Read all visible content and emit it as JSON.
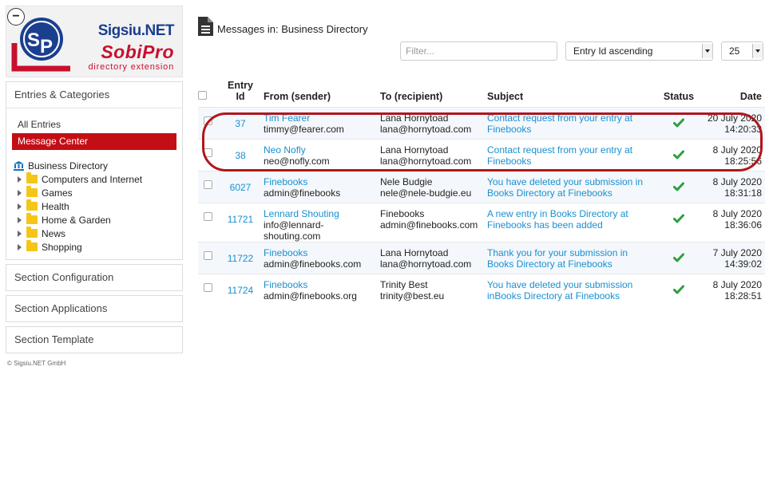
{
  "logo": {
    "collapse_symbol": "−",
    "vendor": "Sigsiu.NET",
    "product": "SobiPro",
    "tagline": "directory extension",
    "brand_blue": "#1b3f8f",
    "brand_red": "#c8102e"
  },
  "sidebar": {
    "entries_header": "Entries & Categories",
    "links": [
      {
        "label": "All Entries",
        "active": false
      },
      {
        "label": "Message Center",
        "active": true
      }
    ],
    "tree_root": "Business Directory",
    "categories": [
      "Computers and Internet",
      "Games",
      "Health",
      "Home & Garden",
      "News",
      "Shopping"
    ],
    "sections": [
      "Section Configuration",
      "Section Applications",
      "Section Template"
    ],
    "copyright": "© Sigsiu.NET GmbH"
  },
  "main": {
    "title": "Messages in: Business Directory",
    "filter_placeholder": "Filter...",
    "sort_value": "Entry Id ascending",
    "limit_value": "25",
    "columns": {
      "entry_id_line1": "Entry",
      "entry_id_line2": "Id",
      "from": "From (sender)",
      "to": "To (recipient)",
      "subject": "Subject",
      "status": "Status",
      "date": "Date"
    },
    "rows": [
      {
        "id": "37",
        "from_name": "Tim Fearer",
        "from_email": "timmy@fearer.com",
        "to_name": "Lana Hornytoad",
        "to_email": "lana@hornytoad.com",
        "subject_1": "Contact request from your entry at",
        "subject_2": "Finebooks",
        "status": "sent",
        "date": "20 July 2020",
        "time": "14:20:33"
      },
      {
        "id": "38",
        "from_name": "Neo Nofly",
        "from_email": "neo@nofly.com",
        "to_name": "Lana Hornytoad",
        "to_email": "lana@hornytoad.com",
        "subject_1": "Contact request from your entry at",
        "subject_2": "Finebooks",
        "status": "sent",
        "date": "8 July 2020",
        "time": "18:25:56"
      },
      {
        "id": "6027",
        "from_name": "Finebooks",
        "from_email": "admin@finebooks",
        "to_name": "Nele Budgie",
        "to_email": "nele@nele-budgie.eu",
        "subject_1": "You have deleted your submission in",
        "subject_2": "Books Directory at Finebooks",
        "status": "sent",
        "date": "8 July 2020",
        "time": "18:31:18"
      },
      {
        "id": "11721",
        "from_name": "Lennard Shouting",
        "from_email": "info@lennard-",
        "from_email_2": "shouting.com",
        "to_name": "Finebooks",
        "to_email": "admin@finebooks.com",
        "subject_1": "A new entry in Books Directory at",
        "subject_2": "Finebooks has been added",
        "status": "sent",
        "date": "8 July 2020",
        "time": "18:36:06"
      },
      {
        "id": "11722",
        "from_name": "Finebooks",
        "from_email": "admin@finebooks.com",
        "to_name": "Lana Hornytoad",
        "to_email": "lana@hornytoad.com",
        "subject_1": "Thank you for your submission in",
        "subject_2": "Books Directory at Finebooks",
        "status": "sent",
        "date": "7 July 2020",
        "time": "14:39:02"
      },
      {
        "id": "11724",
        "from_name": "Finebooks",
        "from_email": "admin@finebooks.org",
        "to_name": "Trinity Best",
        "to_email": "trinity@best.eu",
        "subject_1": "You have deleted your submission",
        "subject_2": "inBooks Directory at Finebooks",
        "status": "sent",
        "date": "8 July 2020",
        "time": "18:28:51"
      }
    ],
    "colors": {
      "link": "#1a8fd0",
      "status_ok": "#2e9e3e",
      "highlight": "#b0161b",
      "active_nav": "#c40e16"
    }
  }
}
